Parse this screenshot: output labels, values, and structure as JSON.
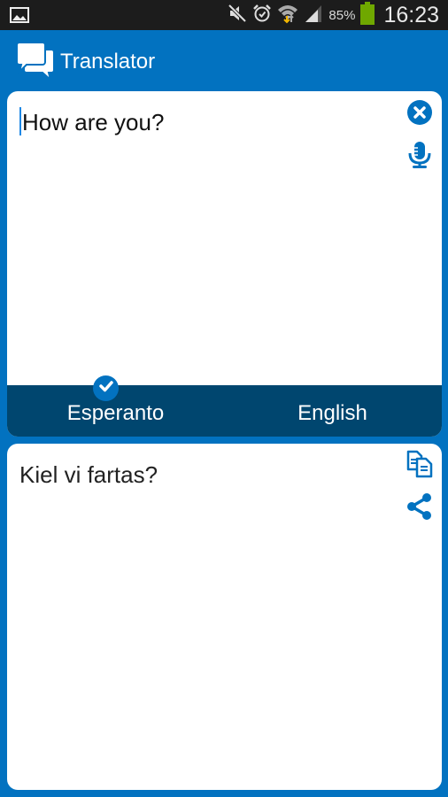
{
  "status_bar": {
    "battery_percent": "85%",
    "time": "16:23",
    "icons": [
      "gallery-icon",
      "mute-icon",
      "alarm-icon",
      "wifi-icon",
      "signal-icon",
      "battery-icon"
    ],
    "battery_color": "#6fa800"
  },
  "app_bar": {
    "title": "Translator",
    "icon": "chat-bubbles-icon"
  },
  "input": {
    "text": "How are you?",
    "clear_icon": "clear-icon",
    "mic_icon": "microphone-icon"
  },
  "languages": {
    "source": "Esperanto",
    "target": "English",
    "selected": "Esperanto"
  },
  "output": {
    "text": "Kiel vi fartas?",
    "copy_icon": "copy-icon",
    "share_icon": "share-icon"
  },
  "colors": {
    "primary": "#0272c0",
    "lang_bar": "#00466f",
    "status_bar": "#1c1c1c"
  }
}
